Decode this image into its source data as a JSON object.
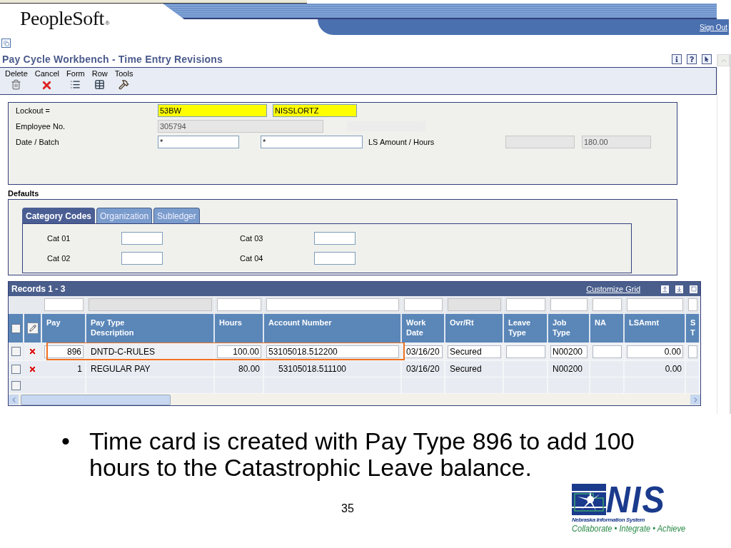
{
  "header": {
    "logo": "PeopleSoft",
    "logo_mark": "®",
    "sign_out": "Sign Out"
  },
  "page_title": "Pay Cycle Workbench - Time Entry Revisions",
  "toolbar": [
    {
      "label": "Delete",
      "kind": "trash"
    },
    {
      "label": "Cancel",
      "kind": "cancel"
    },
    {
      "label": "Form",
      "kind": "form"
    },
    {
      "label": "Row",
      "kind": "row"
    },
    {
      "label": "Tools",
      "kind": "tools"
    }
  ],
  "form": {
    "rows": [
      {
        "label": "Lockout =",
        "kind": "lockout",
        "fields": [
          {
            "value": "53BW",
            "highlighted": true
          },
          {
            "value": "NISSLORTZ",
            "highlighted": true
          }
        ]
      },
      {
        "label": "Employee No.",
        "kind": "employee",
        "fields": [
          {
            "value": "305794",
            "disabled": true
          }
        ]
      },
      {
        "label": "Date / Batch",
        "kind": "batch",
        "fields": [
          {
            "value": "*"
          },
          {
            "value": "*"
          }
        ],
        "second_label": "LS Amount / Hours",
        "second_fields": [
          {
            "disabled": true
          },
          {
            "value": "180.00",
            "disabled": true
          }
        ]
      }
    ]
  },
  "defaults": {
    "label": "Defaults",
    "tabs": [
      {
        "label": "Category Codes",
        "selected": true
      },
      {
        "label": "Organization",
        "selected": false
      },
      {
        "label": "Subledger",
        "selected": false
      }
    ],
    "fields": [
      {
        "label": "Cat 01"
      },
      {
        "label": "Cat 02"
      },
      {
        "label": "Cat 03"
      },
      {
        "label": "Cat 04"
      }
    ]
  },
  "grid": {
    "title": "Records 1 - 3",
    "customize": "Customize Grid",
    "header_checked": false,
    "columns": [
      {
        "label": "Pay",
        "filter_disabled": false
      },
      {
        "label": "Pay Type\nDescription",
        "filter_disabled": true
      },
      {
        "label": "Hours",
        "filter_disabled": false
      },
      {
        "label": "Account Number",
        "filter_disabled": false
      },
      {
        "label": "Work\nDate",
        "filter_disabled": false
      },
      {
        "label": "Ovr/Rt",
        "filter_disabled": true
      },
      {
        "label": "Leave\nType",
        "filter_disabled": false
      },
      {
        "label": "Job\nType",
        "filter_disabled": false
      },
      {
        "label": "NA",
        "filter_disabled": false
      },
      {
        "label": "LSAmnt",
        "filter_disabled": false
      },
      {
        "label": "S\nT",
        "filter_disabled": false
      }
    ],
    "rows": [
      {
        "kind": "entry",
        "checked": false,
        "highlighted": true,
        "cells": [
          {
            "text": "896",
            "input": true
          },
          {
            "text": "DNTD-C-RULES",
            "input": false
          },
          {
            "text": "100.00",
            "input": true
          },
          {
            "text": "53105018.512200",
            "input": true
          },
          {
            "text": "03/16/20",
            "input": true
          },
          {
            "text": "Secured",
            "input": true
          },
          {
            "input": true
          },
          {
            "text": "N00200",
            "input": true
          },
          {
            "input": true
          },
          {
            "text": "0.00",
            "input": true
          },
          {
            "input": true
          }
        ]
      },
      {
        "kind": "saved",
        "checked": false,
        "highlighted": false,
        "cells": [
          {
            "text": "1"
          },
          {
            "text": "REGULAR PAY"
          },
          {
            "text": "80.00"
          },
          {
            "text": "53105018.511100"
          },
          {
            "text": "03/16/20"
          },
          {
            "text": "Secured"
          },
          {},
          {
            "text": "N00200"
          },
          {},
          {
            "text": "0.00"
          },
          {}
        ]
      },
      {
        "kind": "blank",
        "checked": false,
        "highlighted": false
      }
    ]
  },
  "slide": {
    "bullets": [
      {
        "marker": "•",
        "text": "Time card is created with Pay Type 896 to add 100 hours to the Catastrophic Leave balance."
      }
    ],
    "page_number": "35",
    "org_logo": {
      "name": "NIS",
      "subtitle": "Nebraska Information System",
      "tagline": "Collaborate • Integrate • Achieve"
    }
  }
}
